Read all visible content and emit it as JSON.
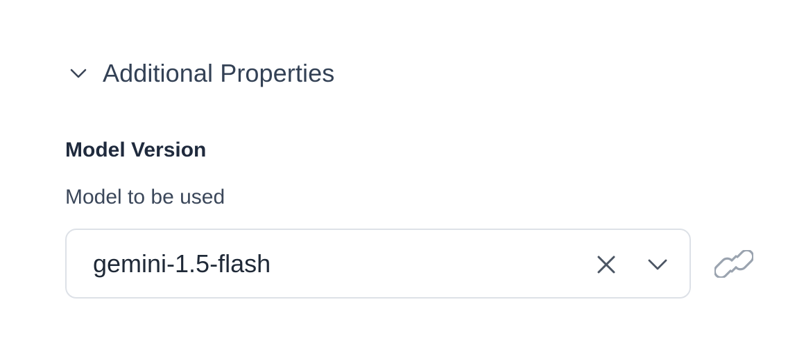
{
  "section": {
    "title": "Additional Properties",
    "toggle_icon": "chevron-down-icon",
    "expanded": true
  },
  "field": {
    "label": "Model Version",
    "help_text": "Model to be used",
    "value": "gemini-1.5-flash",
    "clear_icon": "close-icon",
    "dropdown_icon": "chevron-down-icon",
    "link_icon": "link-icon"
  },
  "colors": {
    "text_primary": "#1f2a3d",
    "text_secondary": "#3b475a",
    "border": "#dde1e7",
    "icon": "#4b5563",
    "link_icon": "#9aa3af"
  }
}
